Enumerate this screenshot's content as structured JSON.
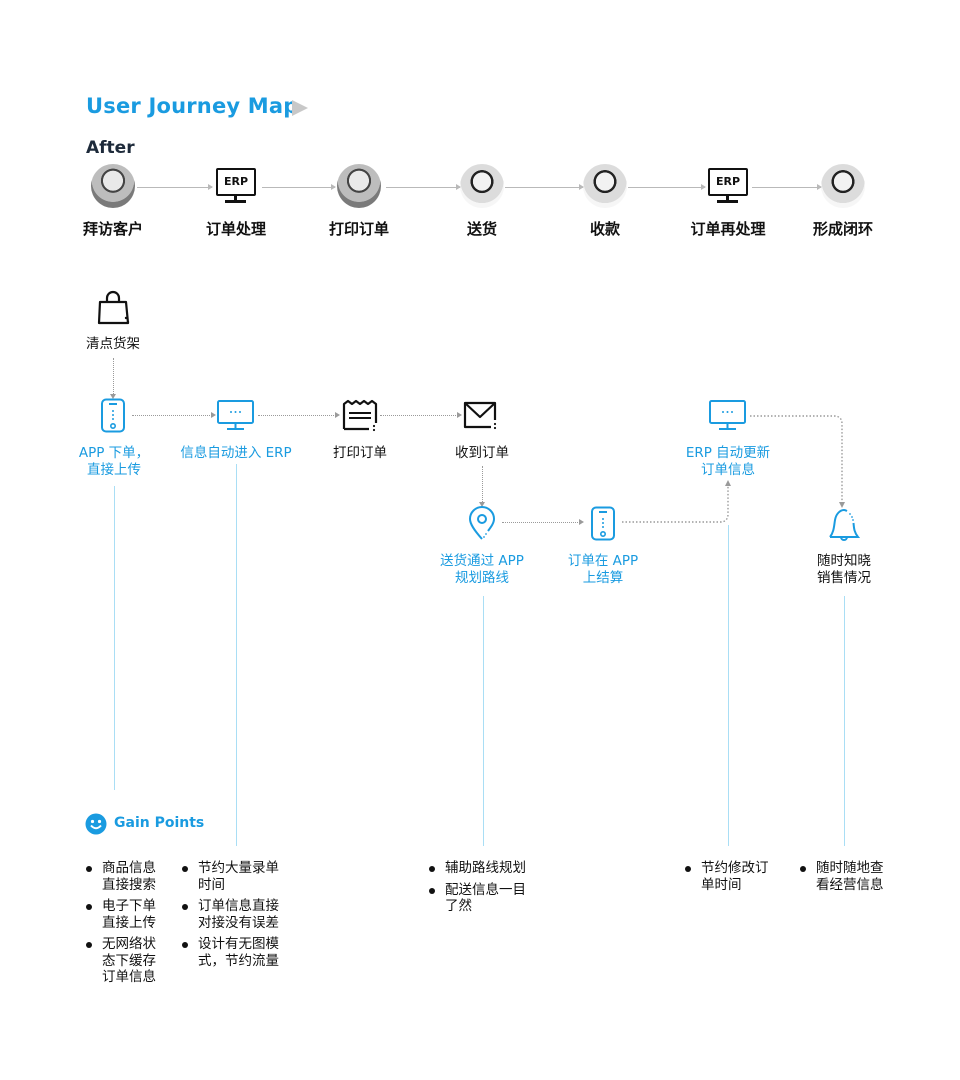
{
  "header": {
    "title": "User Journey Map",
    "subtitle": "After"
  },
  "colors": {
    "accent": "#1a9be0",
    "connector_line": "#a9def5",
    "arrow_gray": "#c8c8c8"
  },
  "journey": [
    {
      "label": "拜访客户",
      "icon": "person-avatar"
    },
    {
      "label": "订单处理",
      "icon": "erp-monitor-icon",
      "icon_text": "ERP"
    },
    {
      "label": "打印订单",
      "icon": "person-avatar"
    },
    {
      "label": "送货",
      "icon": "person-avatar"
    },
    {
      "label": "收款",
      "icon": "person-avatar"
    },
    {
      "label": "订单再处理",
      "icon": "erp-monitor-icon",
      "icon_text": "ERP"
    },
    {
      "label": "形成闭环",
      "icon": "person-avatar"
    }
  ],
  "flow": {
    "shelf": {
      "label": "清点货架",
      "icon": "shopping-bag-icon"
    },
    "app_order": {
      "line1": "APP 下单，",
      "line2": "直接上传",
      "icon": "phone-icon"
    },
    "auto_erp": {
      "label": "信息自动进入 ERP",
      "icon": "monitor-icon"
    },
    "print": {
      "label": "打印订单",
      "icon": "receipt-icon"
    },
    "receive": {
      "label": "收到订单",
      "icon": "envelope-icon"
    },
    "route": {
      "line1": "送货通过 APP",
      "line2": "规划路线",
      "icon": "location-pin-icon"
    },
    "settle": {
      "line1": "订单在 APP",
      "line2": "上结算",
      "icon": "phone-icon"
    },
    "erp_update": {
      "line1": "ERP 自动更新",
      "line2": "订单信息",
      "icon": "monitor-icon"
    },
    "notify": {
      "line1": "随时知晓",
      "line2": "销售情况",
      "icon": "bell-icon"
    }
  },
  "gain_points": {
    "title": "Gain Points",
    "col1": [
      "商品信息\n直接搜索",
      "电子下单\n直接上传",
      "无网络状\n态下缓存\n订单信息"
    ],
    "col2": [
      "节约大量录单\n时间",
      "订单信息直接\n对接没有误差",
      "设计有无图模\n式，节约流量"
    ],
    "col3": [
      "辅助路线规划",
      "配送信息一目\n了然"
    ],
    "col4": [
      "节约修改订\n单时间"
    ],
    "col5": [
      "随时随地查\n看经营信息"
    ]
  }
}
